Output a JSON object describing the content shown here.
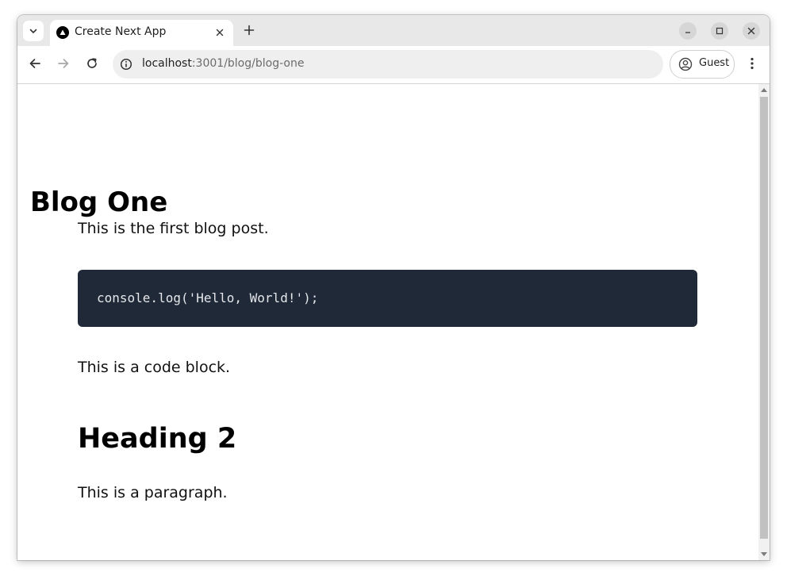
{
  "browser": {
    "tab": {
      "title": "Create Next App",
      "favicon": "nextjs-triangle-icon"
    },
    "address_bar": {
      "host": "localhost",
      "rest": ":3001/blog/blog-one"
    },
    "profile": {
      "label": "Guest",
      "icon": "account-circle-icon"
    },
    "colors": {
      "tabstrip": "#e8e8e8",
      "omnibox": "#efefef",
      "code_bg": "#1f2937",
      "code_text": "#e5e7eb"
    }
  },
  "page": {
    "title": "Blog One",
    "intro": "This is the first blog post.",
    "code": "console.log('Hello, World!');",
    "code_caption": "This is a code block.",
    "heading2": "Heading 2",
    "paragraph": "This is a paragraph."
  }
}
